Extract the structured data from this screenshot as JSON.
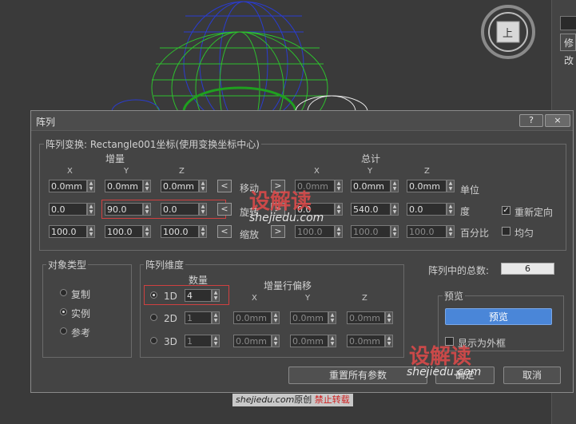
{
  "viewport": {
    "cube_label": "上",
    "panel_tab": "修改"
  },
  "dialog": {
    "title": "阵列",
    "help_btn": "?",
    "close_btn": "×",
    "transform_group_label": "阵列变换: Rectangle001坐标(使用变换坐标中心)",
    "incr_header": "增量",
    "total_header": "总计",
    "axis_x": "X",
    "axis_y": "Y",
    "axis_z": "Z",
    "move_label": "移动",
    "rotate_label": "旋转",
    "scale_label": "缩放",
    "arrow_left": "<",
    "arrow_right": ">",
    "incr_move": [
      "0.0mm",
      "0.0mm",
      "0.0mm"
    ],
    "incr_rotate": [
      "0.0",
      "90.0",
      "0.0"
    ],
    "incr_scale": [
      "100.0",
      "100.0",
      "100.0"
    ],
    "total_move": [
      "0.0mm",
      "0.0mm",
      "0.0mm"
    ],
    "total_rotate": [
      "0.0",
      "540.0",
      "0.0"
    ],
    "total_scale": [
      "100.0",
      "100.0",
      "100.0"
    ],
    "unit_label": "单位",
    "degree_label": "度",
    "percent_label": "百分比",
    "reorient_label": "重新定向",
    "reorient_checked": true,
    "uniform_label": "均匀",
    "uniform_checked": false,
    "object_type": {
      "label": "对象类型",
      "options": [
        "复制",
        "实例",
        "参考"
      ],
      "selected": 1
    },
    "dimensions": {
      "label": "阵列维度",
      "count_header": "数量",
      "offset_header": "增量行偏移",
      "rows": [
        {
          "label": "1D",
          "count": "4",
          "x": "",
          "y": "",
          "z": ""
        },
        {
          "label": "2D",
          "count": "1",
          "x": "0.0mm",
          "y": "0.0mm",
          "z": "0.0mm"
        },
        {
          "label": "3D",
          "count": "1",
          "x": "0.0mm",
          "y": "0.0mm",
          "z": "0.0mm"
        }
      ]
    },
    "total_in_array_label": "阵列中的总数:",
    "total_in_array_value": "6",
    "preview": {
      "label": "预览",
      "button": "预览",
      "show_box_label": "显示为外框"
    },
    "reset_btn": "重置所有参数",
    "ok_btn": "确定",
    "cancel_btn": "取消"
  },
  "watermark": {
    "brand": "设解读",
    "site": "shejiedu.com",
    "caption_site": "shejiedu.com",
    "caption_original": "原创",
    "caption_forbid": "禁止转载"
  },
  "colors": {
    "accent": "#4a86d8",
    "highlight_box": "#d04040",
    "dialog_bg": "#444444"
  }
}
